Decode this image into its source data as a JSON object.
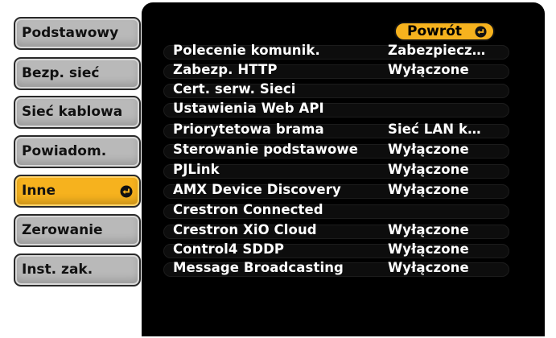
{
  "tabs": [
    {
      "label": "Podstawowy",
      "active": false
    },
    {
      "label": "Bezp. sieć",
      "active": false
    },
    {
      "label": "Sieć kablowa",
      "active": false
    },
    {
      "label": "Powiadom.",
      "active": false
    },
    {
      "label": "Inne",
      "active": true
    },
    {
      "label": "Zerowanie",
      "active": false
    },
    {
      "label": "Inst. zak.",
      "active": false
    }
  ],
  "back_button": {
    "label": "Powrót"
  },
  "settings": [
    {
      "label": "Polecenie komunik.",
      "value": "Zabezpiecz…"
    },
    {
      "label": "Zabezp. HTTP",
      "value": "Wyłączone"
    },
    {
      "label": "Cert. serw. Sieci",
      "value": ""
    },
    {
      "label": "Ustawienia Web API",
      "value": ""
    },
    {
      "label": "Priorytetowa brama",
      "value": "Sieć LAN k…"
    },
    {
      "label": "Sterowanie podstawowe",
      "value": "Wyłączone"
    },
    {
      "label": "PJLink",
      "value": "Wyłączone"
    },
    {
      "label": "AMX Device Discovery",
      "value": "Wyłączone"
    },
    {
      "label": "Crestron Connected",
      "value": ""
    },
    {
      "label": "Crestron XiO Cloud",
      "value": "Wyłączone"
    },
    {
      "label": "Control4 SDDP",
      "value": "Wyłączone"
    },
    {
      "label": "Message Broadcasting",
      "value": "Wyłączone"
    }
  ],
  "colors": {
    "accent": "#f6b21e",
    "tab_inactive": "#b9b9b9",
    "panel_bg": "#000000"
  },
  "icons": {
    "enter": "enter-icon"
  }
}
